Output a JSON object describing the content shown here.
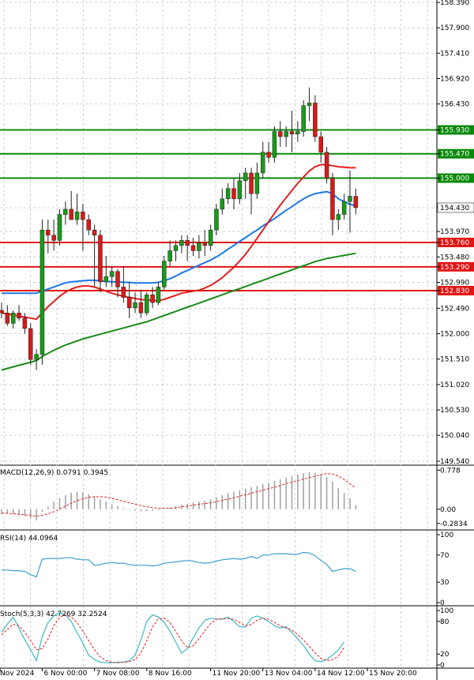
{
  "chart_data": {
    "type": "candlestick",
    "instrument_note": "",
    "price_axis": {
      "ticks": [
        "158.390",
        "157.900",
        "157.410",
        "156.920",
        "156.430",
        "155.930",
        "155.470",
        "155.000",
        "154.430",
        "153.970",
        "153.760",
        "153.480",
        "153.290",
        "152.990",
        "152.830",
        "152.490",
        "152.000",
        "151.510",
        "151.020",
        "150.530",
        "150.040",
        "149.540"
      ],
      "tick_values": [
        158.39,
        157.9,
        157.41,
        156.92,
        156.43,
        155.93,
        155.47,
        155.0,
        154.43,
        153.97,
        153.76,
        153.48,
        153.29,
        152.99,
        152.83,
        152.49,
        152.0,
        151.51,
        151.02,
        150.53,
        150.04,
        149.54
      ],
      "current_price": "154.430",
      "ylim": [
        149.48,
        158.46
      ]
    },
    "time_axis": {
      "labels": [
        "Nov 2024",
        "6 Nov 00:00",
        "7 Nov 08:00",
        "8 Nov 16:00",
        "11 Nov 20:00",
        "13 Nov 04:00",
        "14 Nov 12:00",
        "15 Nov 20:00"
      ],
      "label_index": [
        0,
        7,
        16,
        25,
        36,
        45,
        54,
        63
      ]
    },
    "levels": [
      {
        "label": "155.930",
        "value": 155.93,
        "color": "#0a8a0a"
      },
      {
        "label": "155.470",
        "value": 155.47,
        "color": "#0a8a0a"
      },
      {
        "label": "155.000",
        "value": 155.0,
        "color": "#0a8a0a"
      },
      {
        "label": "153.760",
        "value": 153.76,
        "color": "#e01414"
      },
      {
        "label": "153.290",
        "value": 153.29,
        "color": "#e01414"
      },
      {
        "label": "152.830",
        "value": 152.83,
        "color": "#e01414"
      }
    ],
    "candles": [
      {
        "o": 152.45,
        "h": 152.6,
        "l": 152.3,
        "c": 152.4
      },
      {
        "o": 152.4,
        "h": 152.55,
        "l": 152.15,
        "c": 152.2
      },
      {
        "o": 152.2,
        "h": 152.45,
        "l": 152.1,
        "c": 152.4
      },
      {
        "o": 152.4,
        "h": 152.55,
        "l": 152.25,
        "c": 152.3
      },
      {
        "o": 152.3,
        "h": 152.4,
        "l": 152.0,
        "c": 152.1
      },
      {
        "o": 152.1,
        "h": 152.2,
        "l": 151.4,
        "c": 151.5
      },
      {
        "o": 151.5,
        "h": 151.7,
        "l": 151.3,
        "c": 151.6
      },
      {
        "o": 151.6,
        "h": 154.2,
        "l": 151.4,
        "c": 154.0
      },
      {
        "o": 154.0,
        "h": 154.2,
        "l": 153.55,
        "c": 153.9
      },
      {
        "o": 153.9,
        "h": 154.2,
        "l": 153.6,
        "c": 153.8
      },
      {
        "o": 153.8,
        "h": 154.4,
        "l": 153.7,
        "c": 154.3
      },
      {
        "o": 154.3,
        "h": 154.55,
        "l": 154.1,
        "c": 154.4
      },
      {
        "o": 154.4,
        "h": 154.75,
        "l": 154.2,
        "c": 154.2
      },
      {
        "o": 154.2,
        "h": 154.7,
        "l": 154.1,
        "c": 154.35
      },
      {
        "o": 154.35,
        "h": 154.5,
        "l": 153.6,
        "c": 154.2
      },
      {
        "o": 154.2,
        "h": 154.3,
        "l": 153.9,
        "c": 154.0
      },
      {
        "o": 154.0,
        "h": 154.1,
        "l": 152.9,
        "c": 153.9
      },
      {
        "o": 153.9,
        "h": 154.0,
        "l": 152.8,
        "c": 153.0
      },
      {
        "o": 153.0,
        "h": 153.5,
        "l": 152.9,
        "c": 153.1
      },
      {
        "o": 153.1,
        "h": 153.3,
        "l": 152.9,
        "c": 153.2
      },
      {
        "o": 153.2,
        "h": 153.25,
        "l": 152.7,
        "c": 152.9
      },
      {
        "o": 152.9,
        "h": 153.3,
        "l": 152.6,
        "c": 152.7
      },
      {
        "o": 152.7,
        "h": 153.0,
        "l": 152.3,
        "c": 152.5
      },
      {
        "o": 152.5,
        "h": 152.8,
        "l": 152.4,
        "c": 152.6
      },
      {
        "o": 152.6,
        "h": 152.85,
        "l": 152.3,
        "c": 152.4
      },
      {
        "o": 152.4,
        "h": 152.8,
        "l": 152.35,
        "c": 152.75
      },
      {
        "o": 152.75,
        "h": 152.9,
        "l": 152.5,
        "c": 152.6
      },
      {
        "o": 152.6,
        "h": 153.0,
        "l": 152.55,
        "c": 152.9
      },
      {
        "o": 152.9,
        "h": 153.5,
        "l": 152.85,
        "c": 153.4
      },
      {
        "o": 153.4,
        "h": 153.8,
        "l": 153.3,
        "c": 153.6
      },
      {
        "o": 153.6,
        "h": 153.8,
        "l": 153.4,
        "c": 153.7
      },
      {
        "o": 153.7,
        "h": 153.9,
        "l": 153.55,
        "c": 153.8
      },
      {
        "o": 153.8,
        "h": 153.9,
        "l": 153.4,
        "c": 153.7
      },
      {
        "o": 153.7,
        "h": 153.85,
        "l": 153.5,
        "c": 153.6
      },
      {
        "o": 153.6,
        "h": 153.9,
        "l": 153.45,
        "c": 153.75
      },
      {
        "o": 153.75,
        "h": 154.0,
        "l": 153.5,
        "c": 153.7
      },
      {
        "o": 153.7,
        "h": 154.1,
        "l": 153.6,
        "c": 154.0
      },
      {
        "o": 154.0,
        "h": 154.5,
        "l": 153.9,
        "c": 154.4
      },
      {
        "o": 154.4,
        "h": 154.8,
        "l": 154.3,
        "c": 154.6
      },
      {
        "o": 154.6,
        "h": 154.9,
        "l": 154.5,
        "c": 154.8
      },
      {
        "o": 154.8,
        "h": 155.0,
        "l": 154.4,
        "c": 154.6
      },
      {
        "o": 154.6,
        "h": 155.1,
        "l": 154.5,
        "c": 154.95
      },
      {
        "o": 154.95,
        "h": 155.2,
        "l": 154.6,
        "c": 155.1
      },
      {
        "o": 155.1,
        "h": 155.2,
        "l": 154.3,
        "c": 154.7
      },
      {
        "o": 154.7,
        "h": 155.3,
        "l": 154.6,
        "c": 155.1
      },
      {
        "o": 155.1,
        "h": 155.7,
        "l": 155.0,
        "c": 155.5
      },
      {
        "o": 155.5,
        "h": 155.7,
        "l": 155.3,
        "c": 155.4
      },
      {
        "o": 155.4,
        "h": 156.0,
        "l": 155.3,
        "c": 155.9
      },
      {
        "o": 155.9,
        "h": 156.1,
        "l": 155.6,
        "c": 155.8
      },
      {
        "o": 155.8,
        "h": 156.0,
        "l": 155.6,
        "c": 155.9
      },
      {
        "o": 155.9,
        "h": 156.3,
        "l": 155.5,
        "c": 155.85
      },
      {
        "o": 155.85,
        "h": 156.1,
        "l": 155.7,
        "c": 155.9
      },
      {
        "o": 155.9,
        "h": 156.5,
        "l": 155.8,
        "c": 156.4
      },
      {
        "o": 156.4,
        "h": 156.75,
        "l": 156.1,
        "c": 156.45
      },
      {
        "o": 156.45,
        "h": 156.6,
        "l": 155.7,
        "c": 155.8
      },
      {
        "o": 155.8,
        "h": 155.9,
        "l": 155.3,
        "c": 155.5
      },
      {
        "o": 155.5,
        "h": 155.6,
        "l": 154.9,
        "c": 155.0
      },
      {
        "o": 155.0,
        "h": 155.1,
        "l": 153.9,
        "c": 154.2
      },
      {
        "o": 154.2,
        "h": 154.4,
        "l": 154.0,
        "c": 154.3
      },
      {
        "o": 154.3,
        "h": 154.7,
        "l": 154.2,
        "c": 154.55
      },
      {
        "o": 154.55,
        "h": 155.15,
        "l": 153.95,
        "c": 154.65
      },
      {
        "o": 154.65,
        "h": 154.8,
        "l": 154.3,
        "c": 154.43
      }
    ],
    "moving_averages": [
      {
        "name": "",
        "color": "#1e78e6",
        "values": [
          152.78,
          152.78,
          152.78,
          152.78,
          152.78,
          152.78,
          152.78,
          152.82,
          152.86,
          152.9,
          152.94,
          152.98,
          153.0,
          153.01,
          153.02,
          153.03,
          153.03,
          153.02,
          153.01,
          153.0,
          153.0,
          152.99,
          152.99,
          152.98,
          152.98,
          152.98,
          152.98,
          152.99,
          153.02,
          153.06,
          153.11,
          153.17,
          153.22,
          153.27,
          153.32,
          153.37,
          153.42,
          153.48,
          153.55,
          153.63,
          153.7,
          153.78,
          153.85,
          153.93,
          154.0,
          154.08,
          154.15,
          154.22,
          154.3,
          154.38,
          154.45,
          154.53,
          154.6,
          154.66,
          154.7,
          154.72,
          154.74,
          154.7,
          154.6,
          154.55,
          154.5,
          154.46
        ]
      },
      {
        "name": "",
        "color": "#e61e1e",
        "values": [
          152.4,
          152.38,
          152.36,
          152.34,
          152.32,
          152.3,
          152.28,
          152.4,
          152.52,
          152.62,
          152.72,
          152.8,
          152.86,
          152.9,
          152.92,
          152.92,
          152.9,
          152.86,
          152.82,
          152.78,
          152.75,
          152.72,
          152.7,
          152.68,
          152.66,
          152.65,
          152.64,
          152.64,
          152.66,
          152.7,
          152.74,
          152.78,
          152.8,
          152.82,
          152.84,
          152.88,
          152.93,
          153.0,
          153.08,
          153.18,
          153.28,
          153.4,
          153.53,
          153.68,
          153.84,
          154.0,
          154.16,
          154.32,
          154.48,
          154.62,
          154.76,
          154.9,
          155.02,
          155.14,
          155.22,
          155.26,
          155.26,
          155.24,
          155.22,
          155.21,
          155.2,
          155.2
        ]
      },
      {
        "name": "",
        "color": "#1a8a1a",
        "values": [
          151.3,
          151.33,
          151.36,
          151.39,
          151.42,
          151.45,
          151.48,
          151.56,
          151.62,
          151.68,
          151.73,
          151.78,
          151.82,
          151.86,
          151.9,
          151.93,
          151.96,
          151.99,
          152.02,
          152.05,
          152.08,
          152.11,
          152.14,
          152.17,
          152.2,
          152.23,
          152.27,
          152.31,
          152.35,
          152.39,
          152.43,
          152.47,
          152.51,
          152.55,
          152.59,
          152.63,
          152.67,
          152.71,
          152.75,
          152.79,
          152.83,
          152.87,
          152.91,
          152.95,
          152.99,
          153.03,
          153.07,
          153.11,
          153.15,
          153.19,
          153.23,
          153.27,
          153.31,
          153.35,
          153.39,
          153.42,
          153.45,
          153.47,
          153.49,
          153.51,
          153.53,
          153.55
        ]
      }
    ],
    "indicators": [
      {
        "label": "MACD(12,26,9) 0.0791 0.3945",
        "ticks": [
          "0.778",
          "0.00",
          "-0.2834"
        ],
        "tick_values": [
          0.778,
          0.0,
          -0.2834
        ],
        "ylim": [
          -0.35,
          0.8
        ],
        "hist": [
          -0.1,
          -0.09,
          -0.1,
          -0.12,
          -0.14,
          -0.18,
          -0.22,
          -0.05,
          0.05,
          0.15,
          0.22,
          0.28,
          0.33,
          0.35,
          0.34,
          0.3,
          0.26,
          0.2,
          0.15,
          0.1,
          0.06,
          0.02,
          -0.01,
          -0.03,
          -0.04,
          -0.04,
          -0.03,
          -0.02,
          0.0,
          0.03,
          0.06,
          0.09,
          0.11,
          0.13,
          0.15,
          0.17,
          0.2,
          0.24,
          0.28,
          0.32,
          0.35,
          0.38,
          0.41,
          0.44,
          0.46,
          0.5,
          0.53,
          0.56,
          0.6,
          0.63,
          0.66,
          0.69,
          0.72,
          0.74,
          0.73,
          0.7,
          0.64,
          0.55,
          0.42,
          0.32,
          0.22,
          0.08
        ],
        "signal": [
          -0.08,
          -0.08,
          -0.09,
          -0.1,
          -0.11,
          -0.12,
          -0.14,
          -0.12,
          -0.09,
          -0.05,
          0.0,
          0.06,
          0.12,
          0.17,
          0.21,
          0.24,
          0.25,
          0.25,
          0.24,
          0.22,
          0.19,
          0.16,
          0.13,
          0.1,
          0.07,
          0.05,
          0.03,
          0.02,
          0.02,
          0.02,
          0.03,
          0.05,
          0.06,
          0.08,
          0.1,
          0.11,
          0.13,
          0.15,
          0.18,
          0.2,
          0.23,
          0.26,
          0.29,
          0.32,
          0.35,
          0.38,
          0.41,
          0.44,
          0.47,
          0.51,
          0.54,
          0.57,
          0.6,
          0.63,
          0.66,
          0.69,
          0.71,
          0.7,
          0.66,
          0.59,
          0.51,
          0.42
        ],
        "colors": {
          "hist": "#a0a0a0",
          "signal": "#e61e1e"
        }
      },
      {
        "label": "RSI(14) 44.0964",
        "ticks": [
          "100",
          "70",
          "30",
          "0"
        ],
        "tick_values": [
          100,
          70,
          30,
          0
        ],
        "ylim": [
          0,
          100
        ],
        "line": [
          48,
          48,
          47,
          47,
          46,
          41,
          38,
          64,
          65,
          65,
          65,
          66,
          66,
          64,
          63,
          63,
          55,
          56,
          58,
          59,
          58,
          58,
          56,
          55,
          55,
          55,
          54,
          55,
          58,
          59,
          60,
          61,
          62,
          61,
          59,
          58,
          59,
          61,
          63,
          64,
          65,
          64,
          65,
          68,
          65,
          70,
          70,
          72,
          72,
          72,
          71,
          71,
          74,
          73,
          69,
          62,
          56,
          46,
          48,
          50,
          50,
          46
        ],
        "colors": {
          "line": "#3c9fd2"
        }
      },
      {
        "label": "Stoch(5,3,3) 42.7269 32.2524",
        "ticks": [
          "100",
          "80",
          "20",
          "0"
        ],
        "tick_values": [
          100,
          80,
          20,
          0
        ],
        "ylim": [
          0,
          100
        ],
        "k": [
          60,
          75,
          88,
          68,
          46,
          28,
          8,
          52,
          78,
          90,
          96,
          92,
          80,
          60,
          40,
          18,
          10,
          5,
          4,
          4,
          5,
          5,
          8,
          18,
          46,
          80,
          92,
          88,
          78,
          62,
          42,
          22,
          30,
          50,
          68,
          82,
          86,
          84,
          84,
          88,
          80,
          70,
          70,
          86,
          90,
          86,
          80,
          72,
          68,
          70,
          60,
          48,
          36,
          20,
          8,
          6,
          10,
          18,
          28,
          42
        ],
        "d": [
          55,
          65,
          75,
          72,
          60,
          45,
          28,
          30,
          48,
          72,
          88,
          92,
          88,
          78,
          62,
          45,
          28,
          15,
          8,
          5,
          4,
          5,
          6,
          10,
          22,
          45,
          70,
          85,
          86,
          78,
          62,
          45,
          32,
          35,
          48,
          63,
          76,
          84,
          85,
          85,
          84,
          78,
          72,
          74,
          82,
          86,
          84,
          78,
          72,
          68,
          64,
          56,
          46,
          34,
          22,
          12,
          8,
          10,
          16,
          32
        ],
        "colors": {
          "k": "#3cb9c8",
          "d": "#e61e1e"
        }
      }
    ],
    "grid": true
  }
}
